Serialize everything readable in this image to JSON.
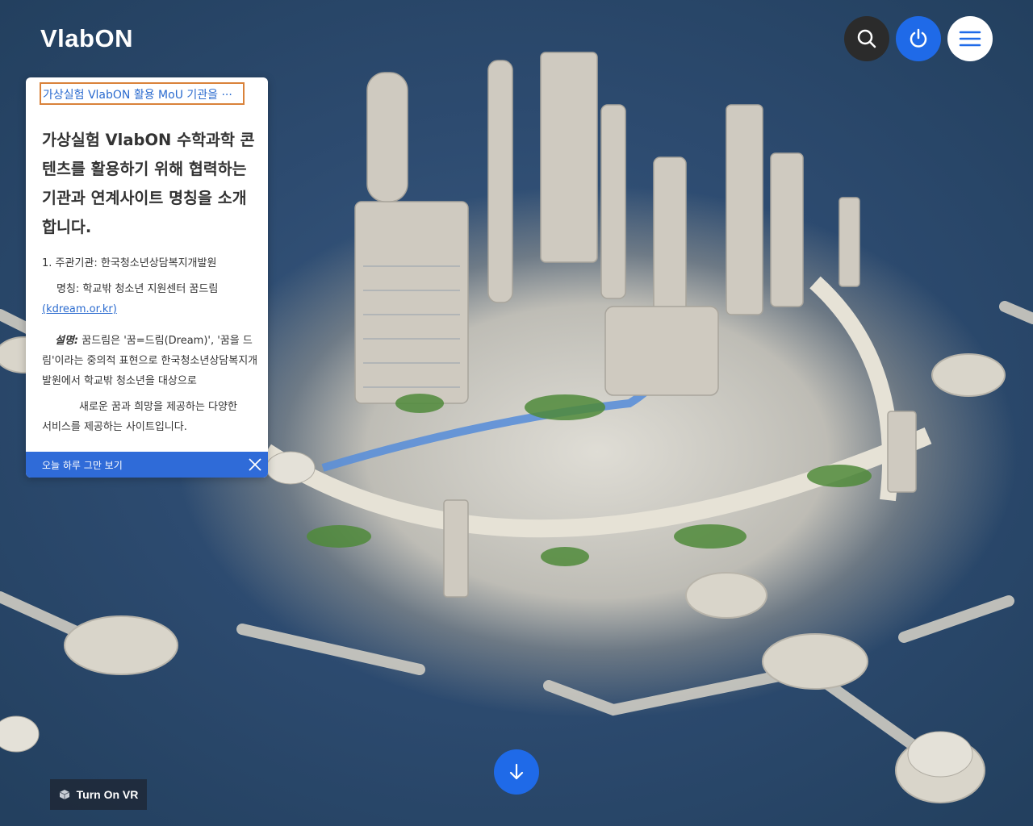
{
  "header": {
    "logo": "VlabON"
  },
  "header_buttons": {
    "search_icon": "search-icon",
    "power_icon": "power-icon",
    "menu_icon": "hamburger-menu-icon"
  },
  "popup": {
    "link_text": "가상실험 VlabON 활용 MoU 기관을 ···",
    "heading": "가상실험 VlabON 수학과학 콘텐츠를 활용하기 위해 협력하는 기관과 연계사이트 명칭을 소개합니다.",
    "item_number": "1.",
    "item_text": "주관기관: 한국청소년상담복지개발원",
    "name_line": "명칭: 학교밖 청소년 지원센터 꿈드림",
    "url": "(kdream.or.kr)",
    "desc_label": "설명:",
    "desc_text": " 꿈드림은 '꿈=드림(Dream)', '꿈을 드림'이라는 중의적 표현으로 한국청소년상담복지개발원에서 학교밖 청소년을 대상으로",
    "desc2_first": "새로운 꿈과 희망을 제공하는 다양한",
    "desc2_rest": "서비스를  제공하는 사이트입니다.",
    "footer_label": "오늘 하루 그만 보기"
  },
  "scroll_button_icon": "arrow-down-icon",
  "vr_button": {
    "label": "Turn On VR",
    "icon": "cube-icon"
  },
  "colors": {
    "accent_blue": "#1f6ae8",
    "link_blue": "#2b6bcf",
    "highlight_border": "#d9823a",
    "footer_blue": "#2f6bd8"
  }
}
